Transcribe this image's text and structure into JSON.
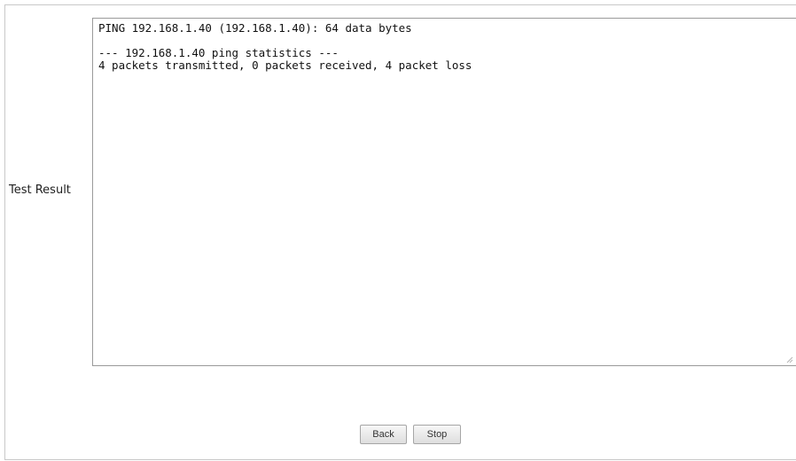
{
  "test_result": {
    "label": "Test Result",
    "output": "PING 192.168.1.40 (192.168.1.40): 64 data bytes\n\n--- 192.168.1.40 ping statistics ---\n4 packets transmitted, 0 packets received, 4 packet loss"
  },
  "buttons": {
    "back_label": "Back",
    "stop_label": "Stop"
  },
  "icons": {
    "resize_grip": "resize-grip-icon"
  }
}
